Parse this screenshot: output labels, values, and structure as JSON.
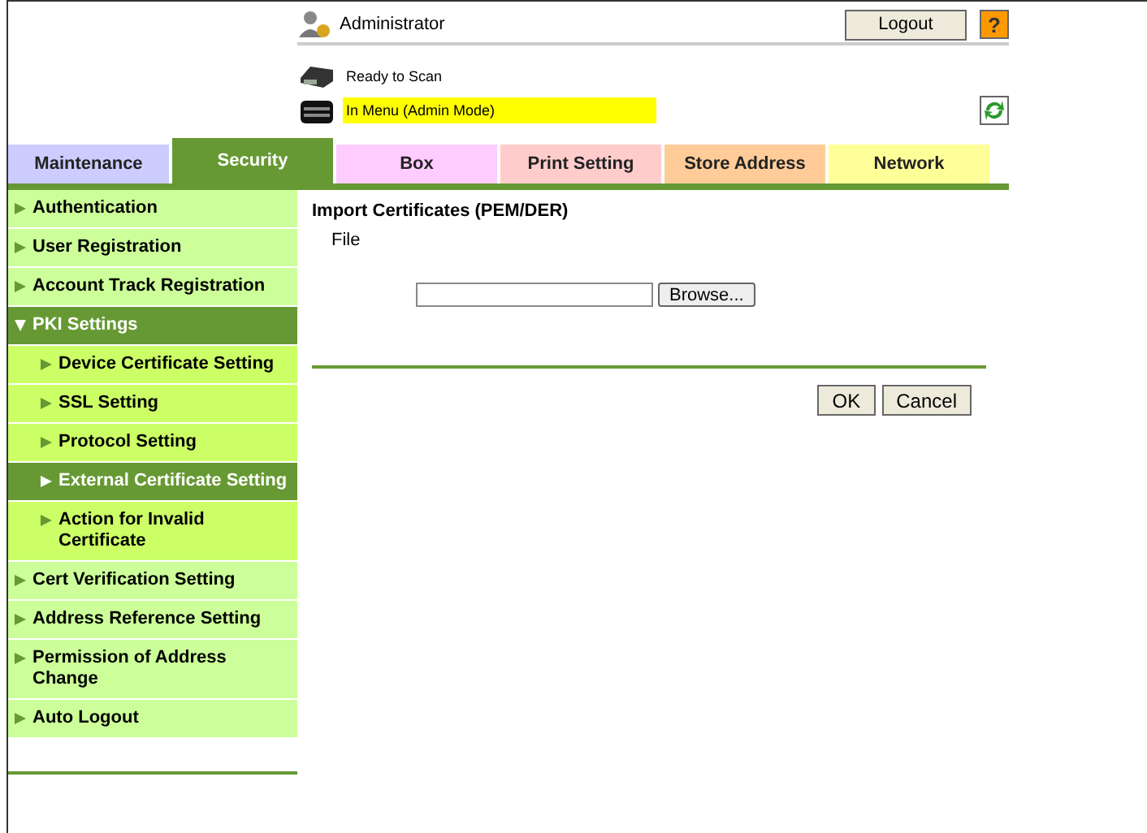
{
  "header": {
    "user": "Administrator",
    "logout": "Logout",
    "help": "?",
    "statuses": [
      {
        "text": "Ready to Scan",
        "highlight": false
      },
      {
        "text": "In Menu (Admin Mode)",
        "highlight": true
      }
    ]
  },
  "tabs": [
    {
      "label": "Maintenance",
      "selected": false,
      "color": "#ccccff"
    },
    {
      "label": "Security",
      "selected": true,
      "color": "#669933"
    },
    {
      "label": "Box",
      "selected": false,
      "color": "#ffccff"
    },
    {
      "label": "Print Setting",
      "selected": false,
      "color": "#ffcccc"
    },
    {
      "label": "Store Address",
      "selected": false,
      "color": "#ffcc99"
    },
    {
      "label": "Network",
      "selected": false,
      "color": "#ffff99"
    }
  ],
  "sidebar": {
    "items": [
      {
        "label": "Authentication",
        "selected": false,
        "expanded": false
      },
      {
        "label": "User Registration",
        "selected": false,
        "expanded": false
      },
      {
        "label": "Account Track Registration",
        "selected": false,
        "expanded": false
      },
      {
        "label": "PKI Settings",
        "selected": true,
        "expanded": true,
        "children": [
          {
            "label": "Device Certificate Setting",
            "selected": false
          },
          {
            "label": "SSL Setting",
            "selected": false
          },
          {
            "label": "Protocol Setting",
            "selected": false
          },
          {
            "label": "External Certificate Setting",
            "selected": true
          },
          {
            "label": "Action for Invalid Certificate",
            "selected": false
          }
        ]
      },
      {
        "label": "Cert Verification Setting",
        "selected": false,
        "expanded": false
      },
      {
        "label": "Address Reference Setting",
        "selected": false,
        "expanded": false
      },
      {
        "label": "Permission of Address Change",
        "selected": false,
        "expanded": false
      },
      {
        "label": "Auto Logout",
        "selected": false,
        "expanded": false
      }
    ]
  },
  "content": {
    "title": "Import Certificates (PEM/DER)",
    "field_label": "File",
    "browse": "Browse...",
    "buttons": [
      "OK",
      "Cancel"
    ]
  }
}
